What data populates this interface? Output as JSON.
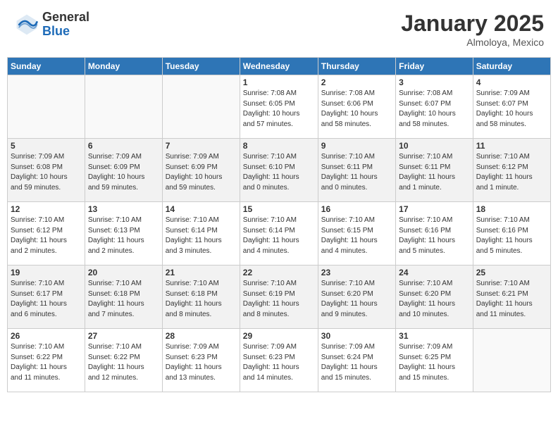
{
  "header": {
    "logo_general": "General",
    "logo_blue": "Blue",
    "month_title": "January 2025",
    "subtitle": "Almoloya, Mexico"
  },
  "weekdays": [
    "Sunday",
    "Monday",
    "Tuesday",
    "Wednesday",
    "Thursday",
    "Friday",
    "Saturday"
  ],
  "weeks": [
    {
      "shaded": false,
      "days": [
        {
          "num": "",
          "info": ""
        },
        {
          "num": "",
          "info": ""
        },
        {
          "num": "",
          "info": ""
        },
        {
          "num": "1",
          "info": "Sunrise: 7:08 AM\nSunset: 6:05 PM\nDaylight: 10 hours\nand 57 minutes."
        },
        {
          "num": "2",
          "info": "Sunrise: 7:08 AM\nSunset: 6:06 PM\nDaylight: 10 hours\nand 58 minutes."
        },
        {
          "num": "3",
          "info": "Sunrise: 7:08 AM\nSunset: 6:07 PM\nDaylight: 10 hours\nand 58 minutes."
        },
        {
          "num": "4",
          "info": "Sunrise: 7:09 AM\nSunset: 6:07 PM\nDaylight: 10 hours\nand 58 minutes."
        }
      ]
    },
    {
      "shaded": true,
      "days": [
        {
          "num": "5",
          "info": "Sunrise: 7:09 AM\nSunset: 6:08 PM\nDaylight: 10 hours\nand 59 minutes."
        },
        {
          "num": "6",
          "info": "Sunrise: 7:09 AM\nSunset: 6:09 PM\nDaylight: 10 hours\nand 59 minutes."
        },
        {
          "num": "7",
          "info": "Sunrise: 7:09 AM\nSunset: 6:09 PM\nDaylight: 10 hours\nand 59 minutes."
        },
        {
          "num": "8",
          "info": "Sunrise: 7:10 AM\nSunset: 6:10 PM\nDaylight: 11 hours\nand 0 minutes."
        },
        {
          "num": "9",
          "info": "Sunrise: 7:10 AM\nSunset: 6:11 PM\nDaylight: 11 hours\nand 0 minutes."
        },
        {
          "num": "10",
          "info": "Sunrise: 7:10 AM\nSunset: 6:11 PM\nDaylight: 11 hours\nand 1 minute."
        },
        {
          "num": "11",
          "info": "Sunrise: 7:10 AM\nSunset: 6:12 PM\nDaylight: 11 hours\nand 1 minute."
        }
      ]
    },
    {
      "shaded": false,
      "days": [
        {
          "num": "12",
          "info": "Sunrise: 7:10 AM\nSunset: 6:12 PM\nDaylight: 11 hours\nand 2 minutes."
        },
        {
          "num": "13",
          "info": "Sunrise: 7:10 AM\nSunset: 6:13 PM\nDaylight: 11 hours\nand 2 minutes."
        },
        {
          "num": "14",
          "info": "Sunrise: 7:10 AM\nSunset: 6:14 PM\nDaylight: 11 hours\nand 3 minutes."
        },
        {
          "num": "15",
          "info": "Sunrise: 7:10 AM\nSunset: 6:14 PM\nDaylight: 11 hours\nand 4 minutes."
        },
        {
          "num": "16",
          "info": "Sunrise: 7:10 AM\nSunset: 6:15 PM\nDaylight: 11 hours\nand 4 minutes."
        },
        {
          "num": "17",
          "info": "Sunrise: 7:10 AM\nSunset: 6:16 PM\nDaylight: 11 hours\nand 5 minutes."
        },
        {
          "num": "18",
          "info": "Sunrise: 7:10 AM\nSunset: 6:16 PM\nDaylight: 11 hours\nand 5 minutes."
        }
      ]
    },
    {
      "shaded": true,
      "days": [
        {
          "num": "19",
          "info": "Sunrise: 7:10 AM\nSunset: 6:17 PM\nDaylight: 11 hours\nand 6 minutes."
        },
        {
          "num": "20",
          "info": "Sunrise: 7:10 AM\nSunset: 6:18 PM\nDaylight: 11 hours\nand 7 minutes."
        },
        {
          "num": "21",
          "info": "Sunrise: 7:10 AM\nSunset: 6:18 PM\nDaylight: 11 hours\nand 8 minutes."
        },
        {
          "num": "22",
          "info": "Sunrise: 7:10 AM\nSunset: 6:19 PM\nDaylight: 11 hours\nand 8 minutes."
        },
        {
          "num": "23",
          "info": "Sunrise: 7:10 AM\nSunset: 6:20 PM\nDaylight: 11 hours\nand 9 minutes."
        },
        {
          "num": "24",
          "info": "Sunrise: 7:10 AM\nSunset: 6:20 PM\nDaylight: 11 hours\nand 10 minutes."
        },
        {
          "num": "25",
          "info": "Sunrise: 7:10 AM\nSunset: 6:21 PM\nDaylight: 11 hours\nand 11 minutes."
        }
      ]
    },
    {
      "shaded": false,
      "days": [
        {
          "num": "26",
          "info": "Sunrise: 7:10 AM\nSunset: 6:22 PM\nDaylight: 11 hours\nand 11 minutes."
        },
        {
          "num": "27",
          "info": "Sunrise: 7:10 AM\nSunset: 6:22 PM\nDaylight: 11 hours\nand 12 minutes."
        },
        {
          "num": "28",
          "info": "Sunrise: 7:09 AM\nSunset: 6:23 PM\nDaylight: 11 hours\nand 13 minutes."
        },
        {
          "num": "29",
          "info": "Sunrise: 7:09 AM\nSunset: 6:23 PM\nDaylight: 11 hours\nand 14 minutes."
        },
        {
          "num": "30",
          "info": "Sunrise: 7:09 AM\nSunset: 6:24 PM\nDaylight: 11 hours\nand 15 minutes."
        },
        {
          "num": "31",
          "info": "Sunrise: 7:09 AM\nSunset: 6:25 PM\nDaylight: 11 hours\nand 15 minutes."
        },
        {
          "num": "",
          "info": ""
        }
      ]
    }
  ]
}
